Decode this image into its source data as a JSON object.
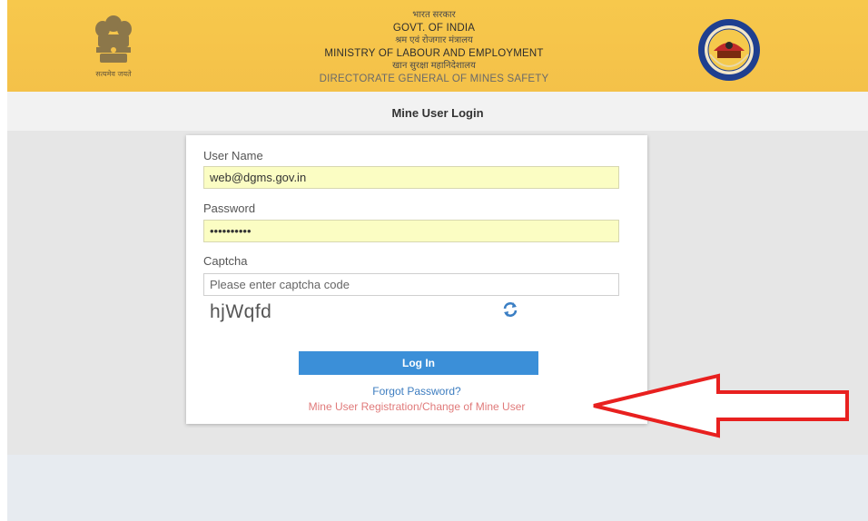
{
  "header": {
    "hindi_line1": "भारत सरकार",
    "english_line1": "GOVT. OF INDIA",
    "hindi_line2": "श्रम एवं रोजगार मंत्रालय",
    "english_line2": "MINISTRY OF LABOUR AND EMPLOYMENT",
    "hindi_line3": "खान सुरक्षा महानिदेशालय",
    "english_line3": "DIRECTORATE GENERAL OF MINES SAFETY",
    "emblem_caption": "सत्यमेव जयते",
    "emblem_icon": "national-emblem-icon",
    "seal_icon": "dgms-seal-icon"
  },
  "page_title": "Mine User Login",
  "form": {
    "username_label": "User Name",
    "username_value": "web@dgms.gov.in",
    "password_label": "Password",
    "password_value": "••••••••••",
    "captcha_label": "Captcha",
    "captcha_placeholder": "Please enter captcha code",
    "captcha_code": "hjWqfd",
    "refresh_icon": "refresh-icon",
    "login_button": "Log In",
    "forgot_link": "Forgot Password?",
    "register_link": "Mine User Registration/Change of Mine User"
  },
  "colors": {
    "header_bg": "#f4c149",
    "button_blue": "#3b8fd8",
    "input_autofill": "#fbfdc3",
    "arrow_red": "#e8201f",
    "register_link": "#e07a7a",
    "forgot_link": "#3d7dc0"
  }
}
